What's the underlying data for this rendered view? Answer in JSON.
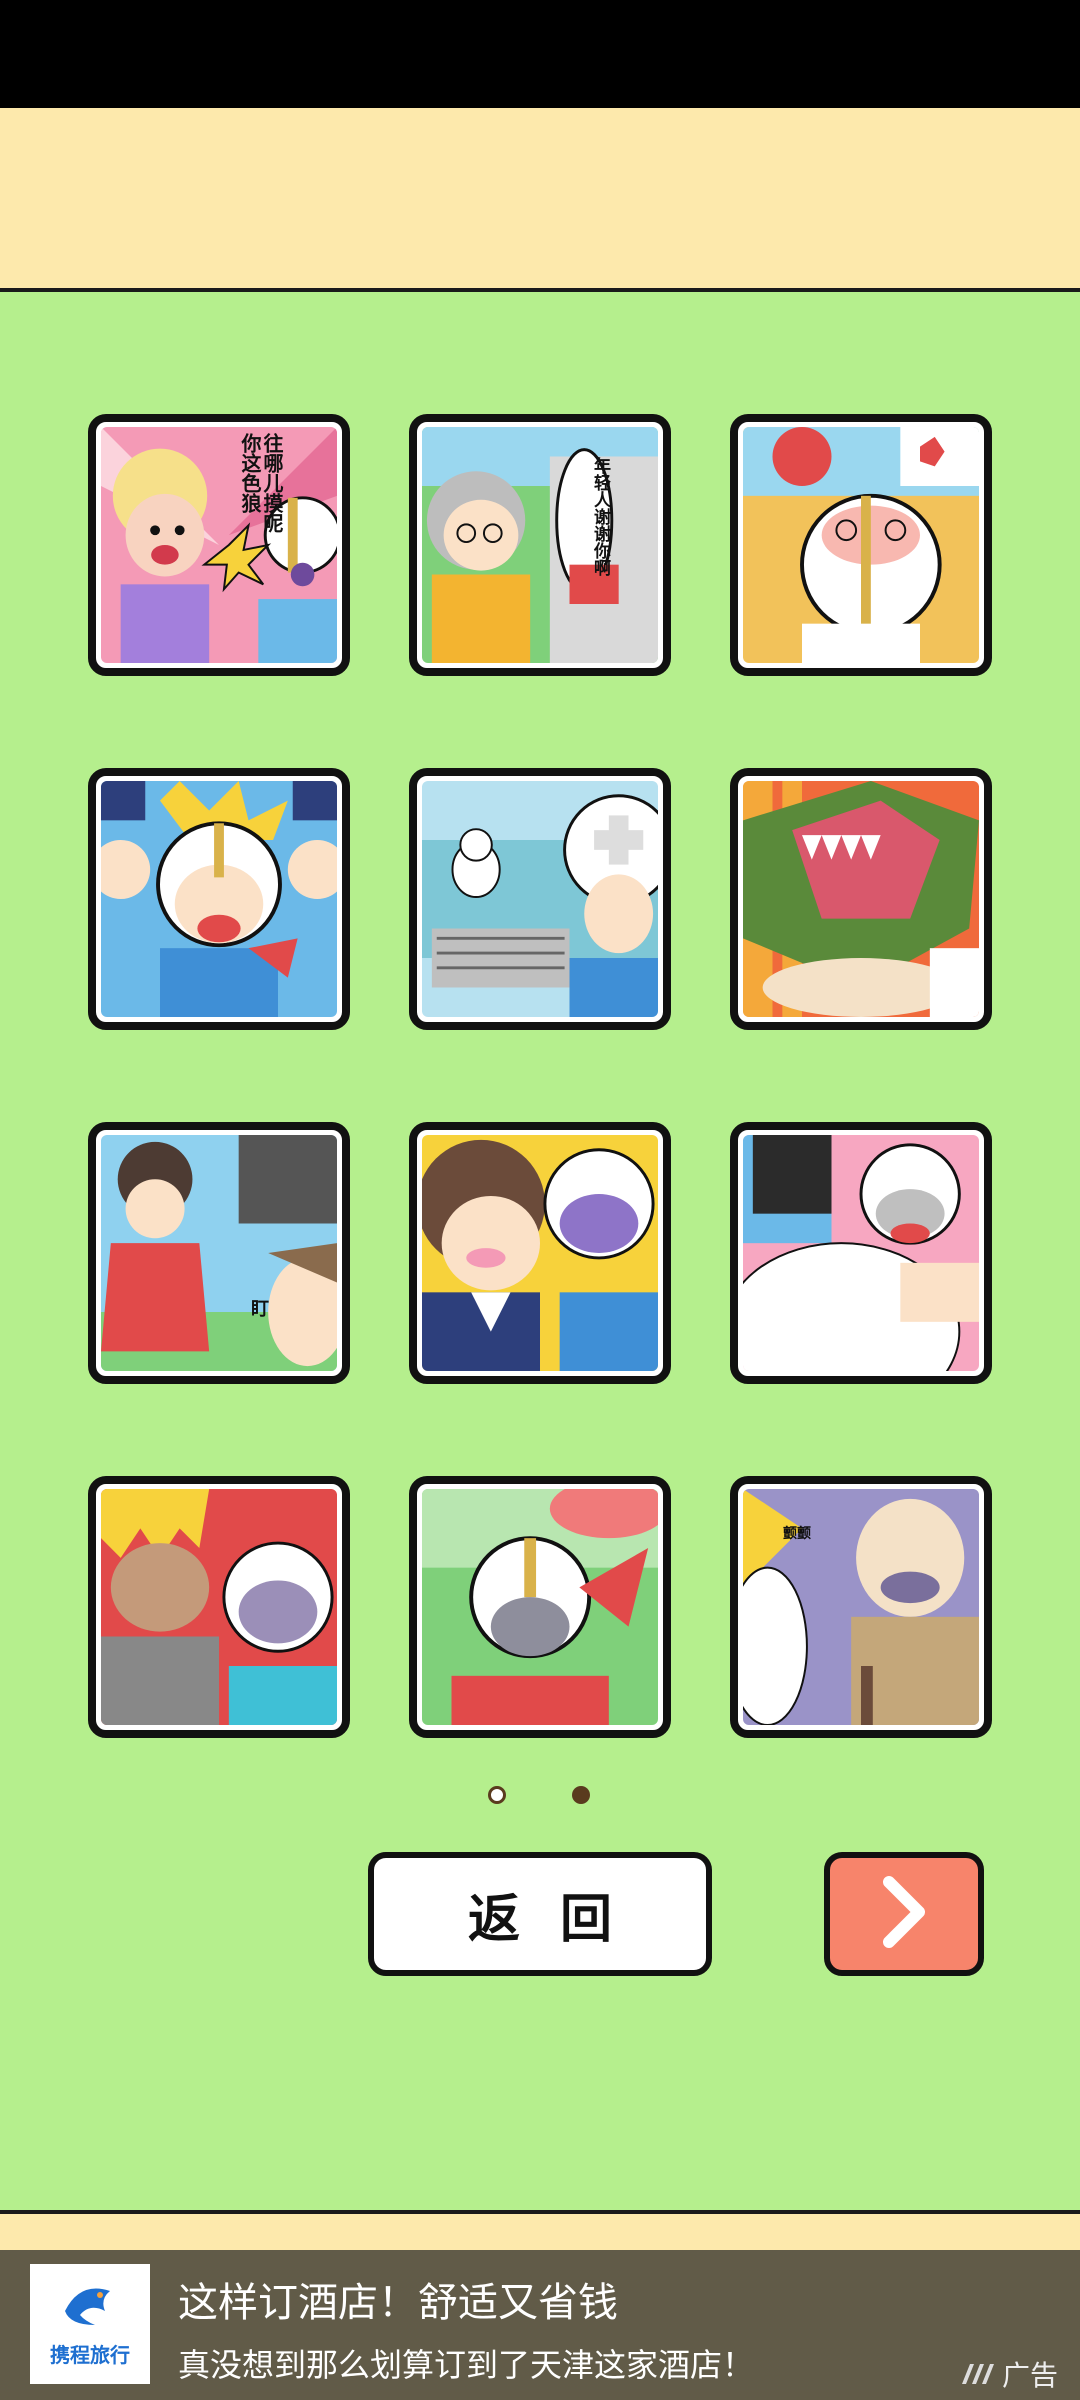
{
  "gallery": {
    "page_count": 2,
    "current_page": 2,
    "tiles": [
      {
        "id": "tile-1",
        "bubble_text": "往哪儿摸呢你这色狼"
      },
      {
        "id": "tile-2",
        "bubble_text": "年轻人谢谢你啊"
      },
      {
        "id": "tile-3",
        "bubble_text": ""
      },
      {
        "id": "tile-4",
        "bubble_text": ""
      },
      {
        "id": "tile-5",
        "bubble_text": ""
      },
      {
        "id": "tile-6",
        "bubble_text": ""
      },
      {
        "id": "tile-7",
        "bubble_text": "盯"
      },
      {
        "id": "tile-8",
        "bubble_text": ""
      },
      {
        "id": "tile-9",
        "bubble_text": ""
      },
      {
        "id": "tile-10",
        "bubble_text": ""
      },
      {
        "id": "tile-11",
        "bubble_text": ""
      },
      {
        "id": "tile-12",
        "bubble_text": "颤颤"
      }
    ]
  },
  "buttons": {
    "back_label": "返回",
    "next_icon": "chevron-right-icon"
  },
  "ad": {
    "brand": "携程旅行",
    "title": "这样订酒店！舒适又省钱",
    "subtitle": "真没想到那么划算订到了天津这家酒店！",
    "tag": "广告"
  },
  "colors": {
    "background": "#b5ef8d",
    "band": "#fde9ac",
    "next_button": "#f7846b",
    "ad_bg": "#615b48"
  }
}
